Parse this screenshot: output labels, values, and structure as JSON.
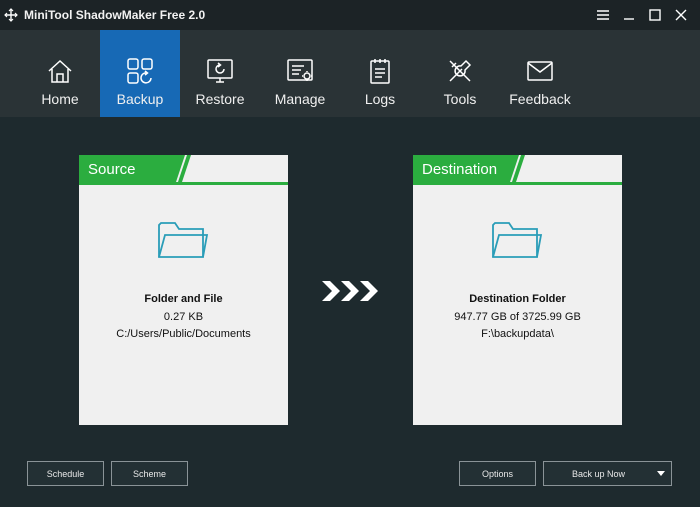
{
  "window": {
    "title": "MiniTool ShadowMaker Free 2.0"
  },
  "toolbar": {
    "items": [
      {
        "label": "Home",
        "icon": "home-icon"
      },
      {
        "label": "Backup",
        "icon": "backup-icon",
        "active": true
      },
      {
        "label": "Restore",
        "icon": "restore-icon"
      },
      {
        "label": "Manage",
        "icon": "manage-icon"
      },
      {
        "label": "Logs",
        "icon": "logs-icon"
      },
      {
        "label": "Tools",
        "icon": "tools-icon"
      },
      {
        "label": "Feedback",
        "icon": "feedback-icon"
      }
    ]
  },
  "source": {
    "tab_label": "Source",
    "name": "Folder and File",
    "size": "0.27 KB",
    "path": "C:/Users/Public/Documents"
  },
  "destination": {
    "tab_label": "Destination",
    "name": "Destination Folder",
    "size": "947.77 GB of 3725.99 GB",
    "path": "F:\\backupdata\\"
  },
  "buttons": {
    "schedule": "Schedule",
    "scheme": "Scheme",
    "options": "Options",
    "backup_now": "Back up Now"
  },
  "colors": {
    "accent_blue": "#1769b5",
    "tab_green": "#2bad3f",
    "background": "#1e2a2e",
    "toolbar": "#2a3336"
  }
}
